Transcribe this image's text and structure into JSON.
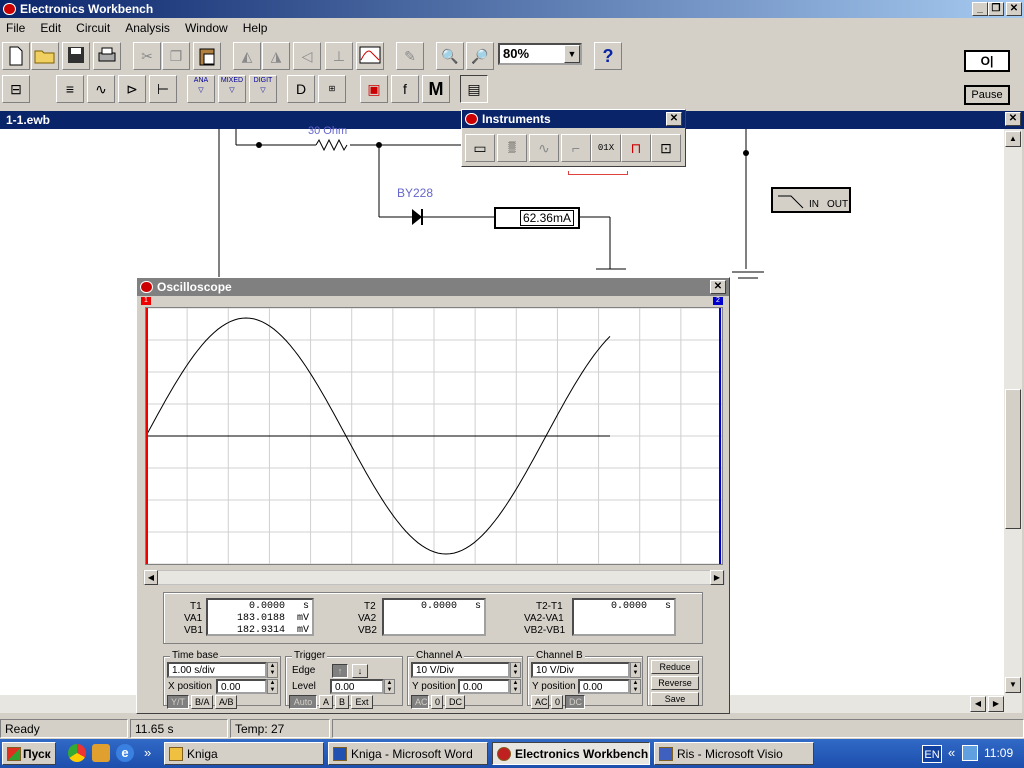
{
  "app": {
    "title": "Electronics Workbench",
    "window_buttons": [
      "_",
      "❐",
      "✕"
    ]
  },
  "menu": [
    "File",
    "Edit",
    "Circuit",
    "Analysis",
    "Window",
    "Help"
  ],
  "toolbar": {
    "zoom": "80%",
    "help_label": "?",
    "power_label": "O|",
    "pause_label": "Pause",
    "parts_labels": [
      "ANA",
      "MIXED",
      "DIGIT"
    ],
    "m_label": "M",
    "f_label": "f"
  },
  "document": {
    "title": "1-1.ewb"
  },
  "circuit": {
    "resistor_label": "30 Ohm",
    "diode_label": "BY228",
    "ammeter_value": "62.36m",
    "ammeter_unit": "A",
    "filter_in": "IN",
    "filter_out": "OUT"
  },
  "instruments": {
    "title": "Instruments",
    "items": [
      "multimeter",
      "function-generator",
      "oscilloscope",
      "bode-plotter",
      "word-generator",
      "logic-analyzer",
      "logic-converter"
    ],
    "word_gen_text": "01X"
  },
  "oscilloscope": {
    "title": "Oscilloscope",
    "cursor1_label": "1",
    "cursor2_label": "2",
    "readout": {
      "t1_label": "T1",
      "t1_value": "0.0000",
      "t1_unit": "s",
      "va1_label": "VA1",
      "va1_value": "183.0188",
      "va1_unit": "mV",
      "vb1_label": "VB1",
      "vb1_value": "182.9314",
      "vb1_unit": "mV",
      "t2_label": "T2",
      "t2_value": "0.0000",
      "t2_unit": "s",
      "va2_label": "VA2",
      "vb2_label": "VB2",
      "dt_label": "T2-T1",
      "dt_value": "0.0000",
      "dt_unit": "s",
      "dva_label": "VA2-VA1",
      "dvb_label": "VB2-VB1"
    },
    "timebase": {
      "group": "Time base",
      "value": "1.00 s/div",
      "xpos_label": "X position",
      "xpos": "0.00",
      "modes": [
        "Y/T",
        "B/A",
        "A/B"
      ]
    },
    "trigger": {
      "group": "Trigger",
      "edge_label": "Edge",
      "level_label": "Level",
      "level": "0.00",
      "sources": [
        "Auto",
        "A",
        "B",
        "Ext"
      ]
    },
    "channel_a": {
      "group": "Channel A",
      "scale": "10  V/Div",
      "ypos_label": "Y position",
      "ypos": "0.00",
      "coupling": [
        "AC",
        "0",
        "DC"
      ]
    },
    "channel_b": {
      "group": "Channel B",
      "scale": "10  V/Div",
      "ypos_label": "Y position",
      "ypos": "0.00",
      "coupling": [
        "AC",
        "0",
        "DC"
      ]
    },
    "actions": [
      "Reduce",
      "Reverse",
      "Save"
    ]
  },
  "status": {
    "state": "Ready",
    "time": "11.65 s",
    "temp": "Temp:  27"
  },
  "taskbar": {
    "start": "Пуск",
    "quicklaunch_more": "»",
    "tasks": [
      "Kniga",
      "Kniga - Microsoft Word",
      "Electronics Workbench",
      "Ris - Microsoft Visio"
    ],
    "lang": "EN",
    "tray_more": "«",
    "clock": "11:09"
  }
}
